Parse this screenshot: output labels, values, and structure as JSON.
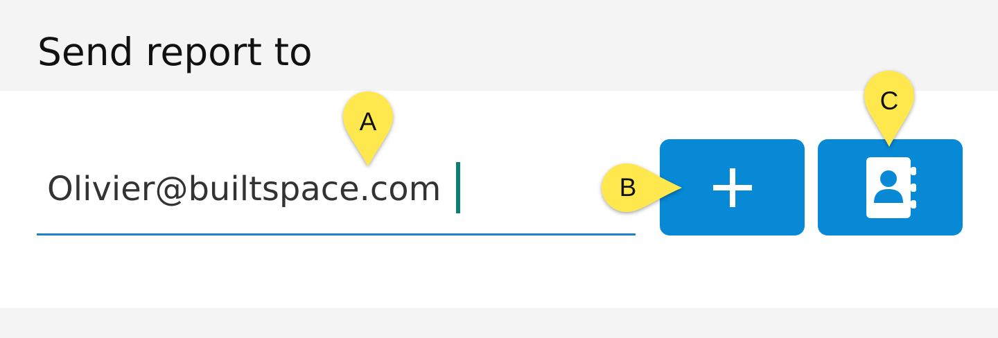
{
  "header": {
    "title": "Send report to"
  },
  "email_input": {
    "value": "Olivier@builtspace.com"
  },
  "buttons": {
    "add_icon": "plus-icon",
    "contacts_icon": "contact-book-icon"
  },
  "callouts": {
    "a": "A",
    "b": "B",
    "c": "C"
  },
  "colors": {
    "accent": "#0789d6",
    "underline": "#1a84c8",
    "caret": "#0f7f74",
    "callout": "#ffe84d",
    "header_bg": "#f4f4f4"
  }
}
